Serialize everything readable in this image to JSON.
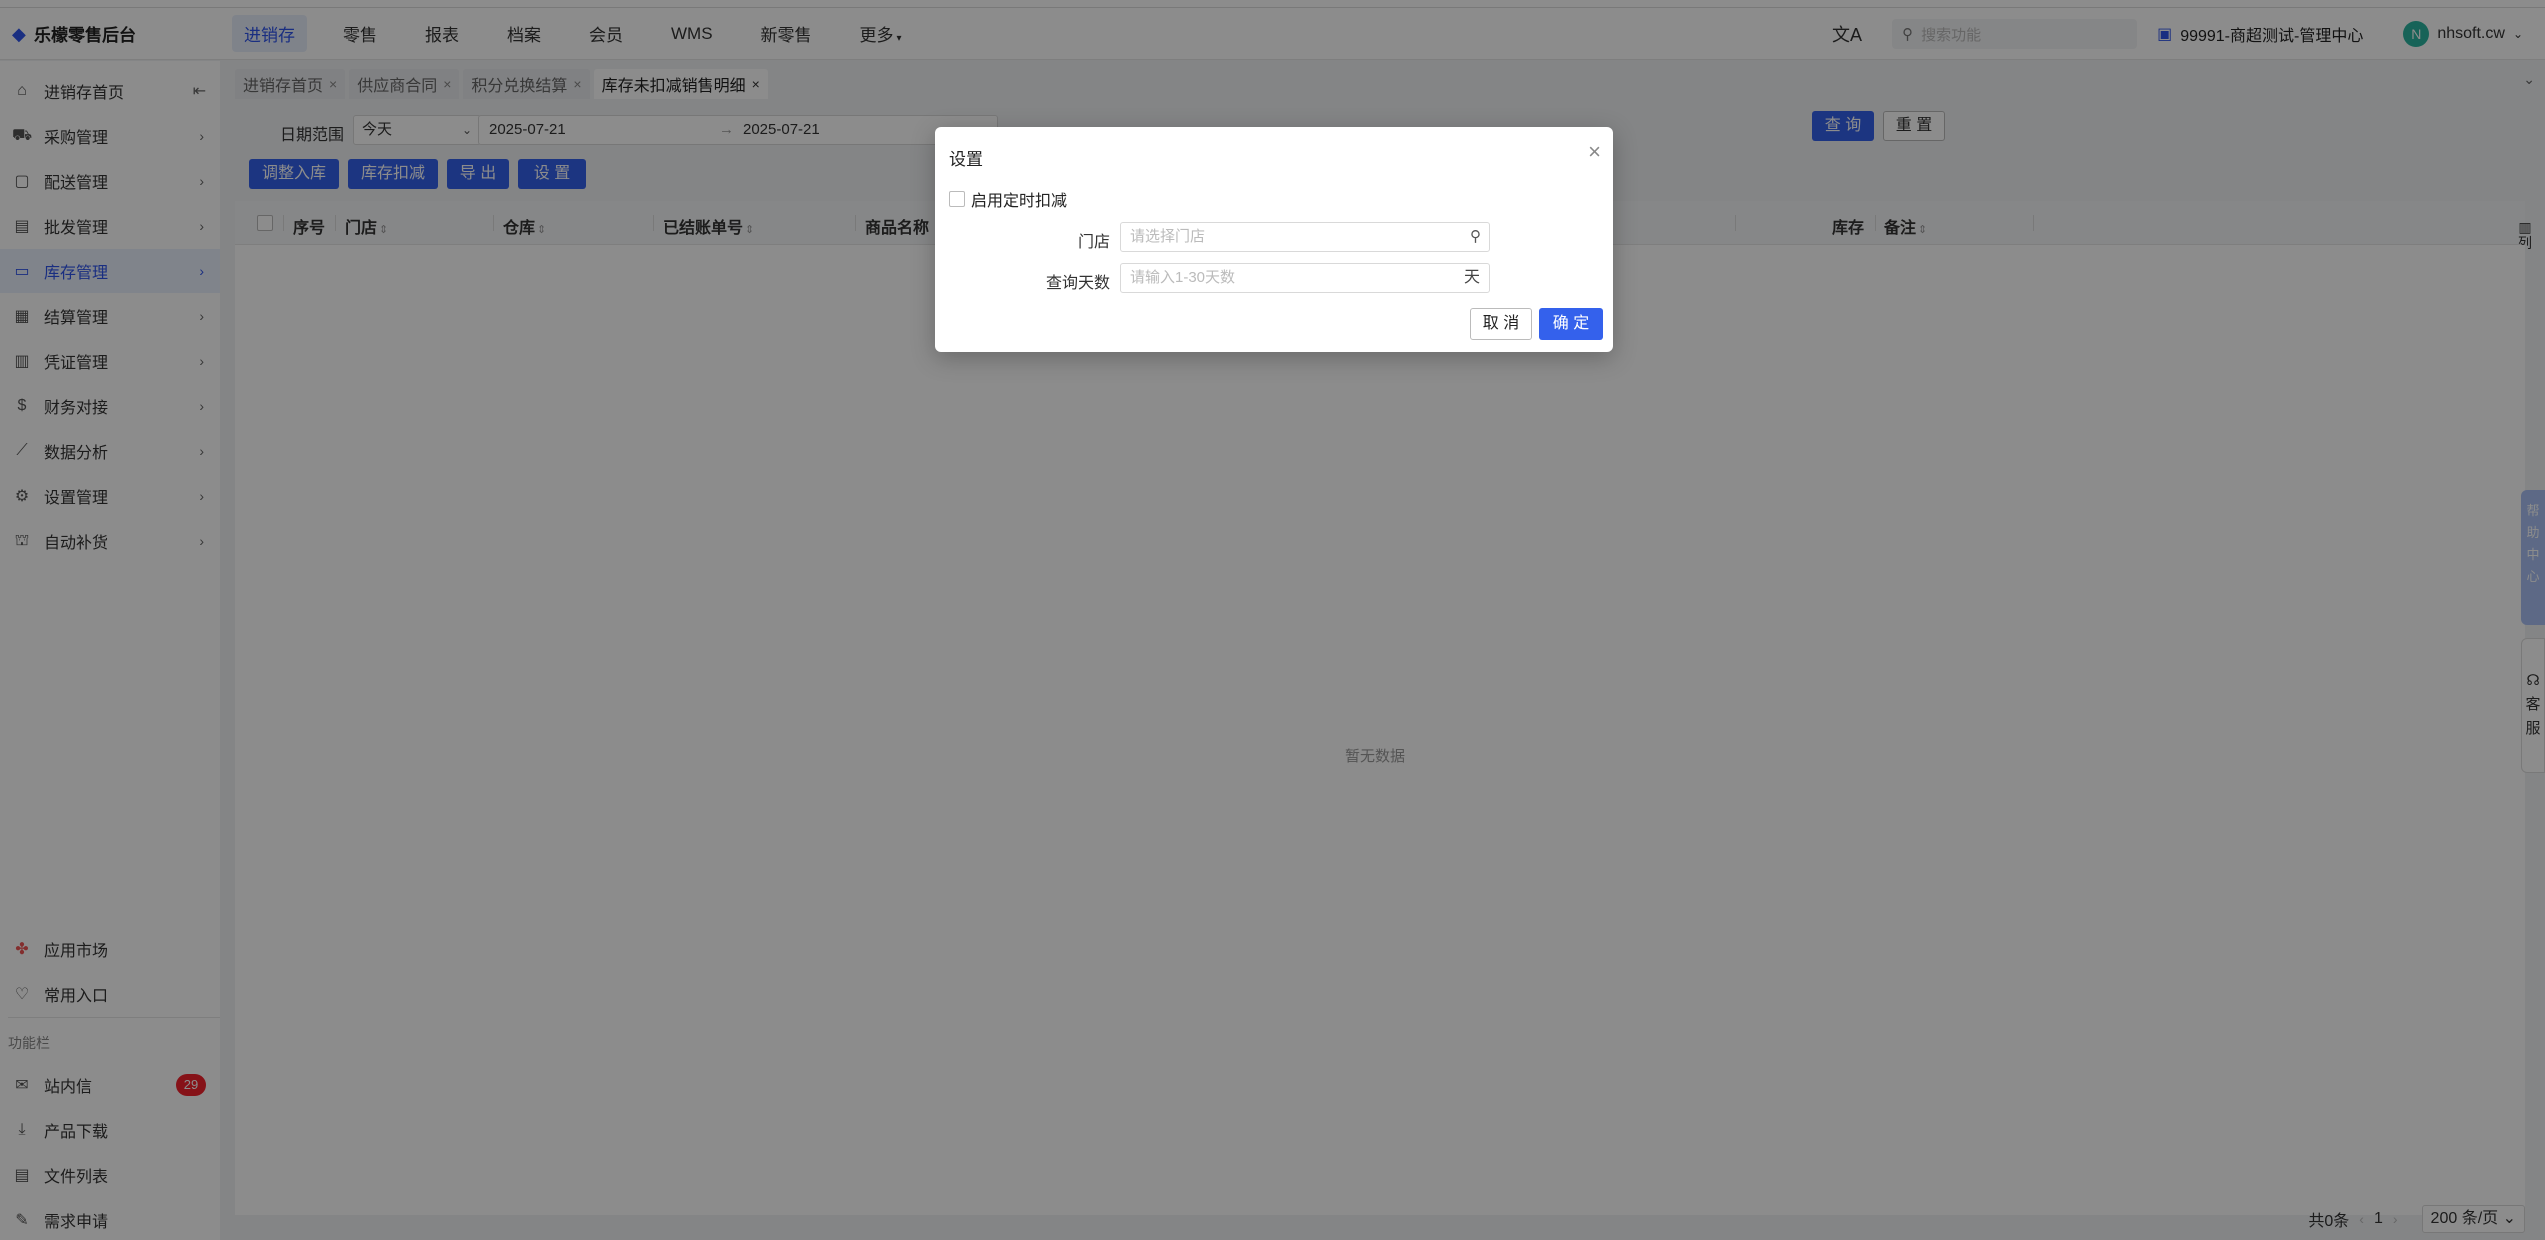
{
  "app": {
    "title": "乐檬零售后台"
  },
  "topnav": [
    {
      "label": "进销存",
      "active": true
    },
    {
      "label": "零售"
    },
    {
      "label": "报表"
    },
    {
      "label": "档案"
    },
    {
      "label": "会员"
    },
    {
      "label": "WMS"
    },
    {
      "label": "新零售"
    },
    {
      "label": "更多"
    }
  ],
  "header": {
    "search_placeholder": "搜索功能",
    "tenant": "99991-商超测试-管理中心",
    "user_initial": "N",
    "user_name": "nhsoft.cw"
  },
  "sidebar": {
    "items": [
      {
        "label": "进销存首页",
        "icon": "home-icon"
      },
      {
        "label": "采购管理",
        "icon": "cart-icon"
      },
      {
        "label": "配送管理",
        "icon": "box-icon"
      },
      {
        "label": "批发管理",
        "icon": "wholesale-icon"
      },
      {
        "label": "库存管理",
        "icon": "inventory-icon",
        "active": true
      },
      {
        "label": "结算管理",
        "icon": "settlement-icon"
      },
      {
        "label": "凭证管理",
        "icon": "voucher-icon"
      },
      {
        "label": "财务对接",
        "icon": "finance-icon"
      },
      {
        "label": "数据分析",
        "icon": "chart-icon"
      },
      {
        "label": "设置管理",
        "icon": "settings-icon"
      },
      {
        "label": "自动补货",
        "icon": "replenish-icon"
      }
    ],
    "bottom": [
      {
        "label": "应用市场",
        "icon": "app-market-icon"
      },
      {
        "label": "常用入口",
        "icon": "heart-icon"
      }
    ],
    "section_label": "功能栏",
    "tools": [
      {
        "label": "站内信",
        "icon": "message-icon",
        "badge": "29"
      },
      {
        "label": "产品下载",
        "icon": "download-icon"
      },
      {
        "label": "文件列表",
        "icon": "file-list-icon"
      },
      {
        "label": "需求申请",
        "icon": "request-icon"
      }
    ]
  },
  "tabs": [
    {
      "label": "进销存首页"
    },
    {
      "label": "供应商合同"
    },
    {
      "label": "积分兑换结算"
    },
    {
      "label": "库存未扣减销售明细",
      "active": true
    }
  ],
  "filters": {
    "date_range_label": "日期范围",
    "date_range_value": "今天",
    "date_start": "2025-07-21",
    "date_end": "2025-07-21",
    "query_button": "查 询",
    "reset_button": "重 置"
  },
  "toolbar": {
    "adjust_in": "调整入库",
    "deduct": "库存扣减",
    "export": "导 出",
    "settings": "设 置"
  },
  "table": {
    "columns": [
      "序号",
      "门店",
      "仓库",
      "已结账单号",
      "商品名称",
      "库存",
      "备注"
    ],
    "empty_text": "暂无数据",
    "col_toggle": "列"
  },
  "pager": {
    "total": "共0条",
    "page": "1",
    "page_size": "200 条/页"
  },
  "float": {
    "help": "帮助中心",
    "service": "客服"
  },
  "modal": {
    "title": "设置",
    "enable_label": "启用定时扣减",
    "store_label": "门店",
    "store_placeholder": "请选择门店",
    "days_label": "查询天数",
    "days_placeholder": "请输入1-30天数",
    "days_suffix": "天",
    "cancel": "取 消",
    "ok": "确 定"
  },
  "colors": {
    "primary": "#3461ec",
    "badge": "#f5222d"
  }
}
